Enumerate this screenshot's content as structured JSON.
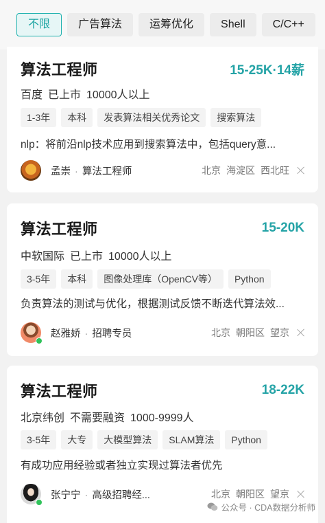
{
  "filters": [
    "不限",
    "广告算法",
    "运筹优化",
    "Shell",
    "C/C++"
  ],
  "jobs": [
    {
      "title": "算法工程师",
      "salary": "15-25K·14薪",
      "company": "百度",
      "stage": "已上市",
      "size": "10000人以上",
      "tags": [
        "1-3年",
        "本科",
        "发表算法相关优秀论文",
        "搜索算法"
      ],
      "desc": "nlp：将前沿nlp技术应用到搜索算法中，包括query意...",
      "recruiter": "孟崇",
      "role": "算法工程师",
      "city": "北京",
      "district": "海淀区",
      "area": "西北旺"
    },
    {
      "title": "算法工程师",
      "salary": "15-20K",
      "company": "中软国际",
      "stage": "已上市",
      "size": "10000人以上",
      "tags": [
        "3-5年",
        "本科",
        "图像处理库（OpenCV等）",
        "Python"
      ],
      "desc": "负责算法的测试与优化，根据测试反馈不断迭代算法效...",
      "recruiter": "赵雅娇",
      "role": "招聘专员",
      "city": "北京",
      "district": "朝阳区",
      "area": "望京"
    },
    {
      "title": "算法工程师",
      "salary": "18-22K",
      "company": "北京纬创",
      "stage": "不需要融资",
      "size": "1000-9999人",
      "tags": [
        "3-5年",
        "大专",
        "大模型算法",
        "SLAM算法",
        "Python"
      ],
      "desc": "有成功应用经验或者独立实现过算法者优先",
      "recruiter": "张宁宁",
      "role": "高级招聘经...",
      "city": "北京",
      "district": "朝阳区",
      "area": "望京"
    }
  ],
  "separator": "·",
  "watermark": "公众号 · CDA数据分析师",
  "colors": {
    "accent": "#24a3a6",
    "online": "#30c25a"
  }
}
